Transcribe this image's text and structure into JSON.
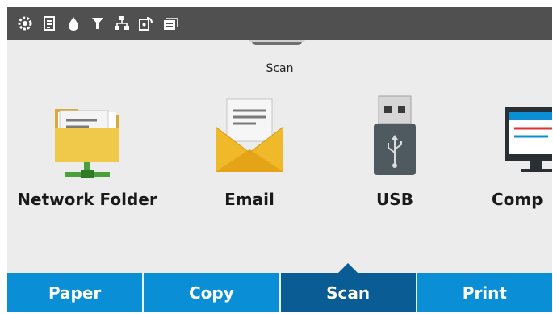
{
  "status_bar": {
    "icons": [
      "gear-icon",
      "document-info-icon",
      "ink-drop-icon",
      "wireless-signal-icon",
      "network-icon",
      "wifi-direct-icon",
      "web-services-icon"
    ]
  },
  "page": {
    "title": "Scan"
  },
  "destinations": [
    {
      "label": "Network Folder",
      "icon": "network-folder-icon"
    },
    {
      "label": "Email",
      "icon": "email-envelope-icon"
    },
    {
      "label": "USB",
      "icon": "usb-drive-icon"
    },
    {
      "label": "Comp",
      "icon": "computer-monitor-icon"
    }
  ],
  "tabs": [
    {
      "label": "Paper",
      "active": false
    },
    {
      "label": "Copy",
      "active": false
    },
    {
      "label": "Scan",
      "active": true
    },
    {
      "label": "Print",
      "active": false
    }
  ],
  "colors": {
    "tab_blue": "#0a8fd6",
    "tab_active": "#0a5c94",
    "status_bar": "#505050",
    "background": "#ececec"
  }
}
